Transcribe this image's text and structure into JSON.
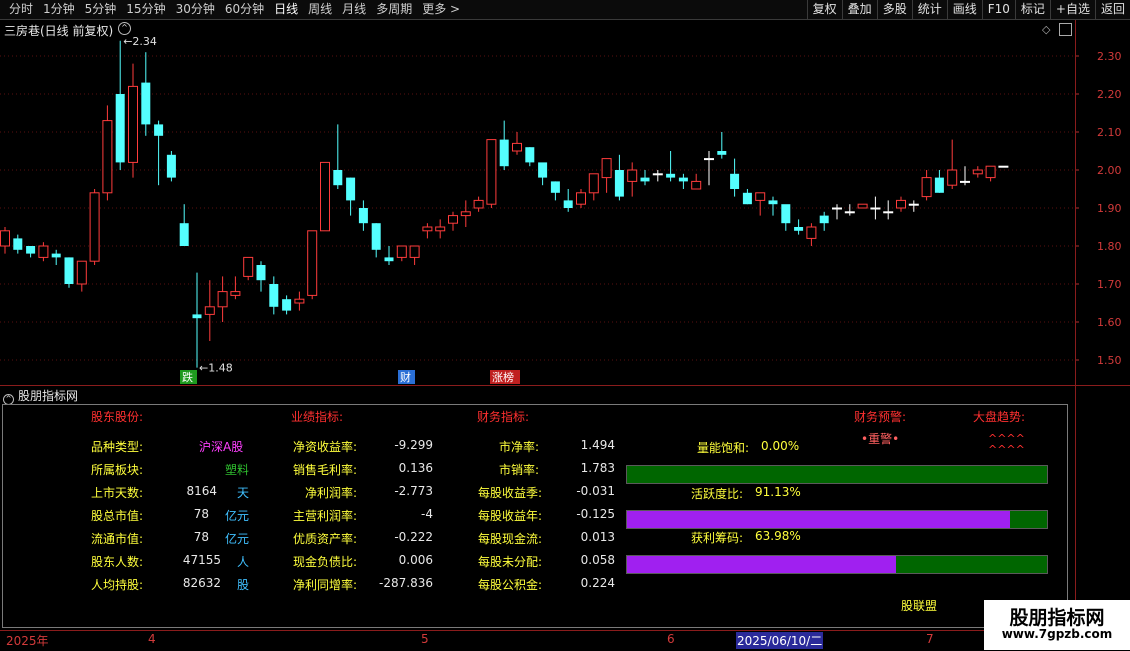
{
  "toolbar": {
    "periods": [
      "分时",
      "1分钟",
      "5分钟",
      "15分钟",
      "30分钟",
      "60分钟",
      "日线",
      "周线",
      "月线",
      "多周期",
      "更多 >"
    ],
    "active_period": "日线",
    "buttons": [
      "复权",
      "叠加",
      "多股",
      "统计",
      "画线",
      "F10",
      "标记",
      "+自选",
      "返回"
    ]
  },
  "chart": {
    "title": "三房巷(日线 前复权)",
    "price_ticks": [
      "2.30",
      "2.20",
      "2.10",
      "2.00",
      "1.90",
      "1.80",
      "1.70",
      "1.60",
      "1.50"
    ],
    "high_label": "2.34",
    "low_label": "1.48",
    "tags": [
      {
        "text": "跌",
        "color": "#1f9a1f"
      },
      {
        "text": "财",
        "color": "#2a6fd6"
      },
      {
        "text": "涨榜",
        "color": "#c02020"
      }
    ],
    "up_color": "#ff3c3c",
    "down_color": "#54ffff",
    "candles": [
      [
        1.8,
        1.84,
        1.85,
        1.78
      ],
      [
        1.82,
        1.79,
        1.83,
        1.78
      ],
      [
        1.8,
        1.78,
        1.8,
        1.77
      ],
      [
        1.77,
        1.8,
        1.81,
        1.76
      ],
      [
        1.78,
        1.77,
        1.79,
        1.75
      ],
      [
        1.77,
        1.7,
        1.77,
        1.69
      ],
      [
        1.7,
        1.76,
        1.76,
        1.68
      ],
      [
        1.76,
        1.94,
        1.95,
        1.75
      ],
      [
        1.94,
        2.13,
        2.17,
        1.92
      ],
      [
        2.2,
        2.02,
        2.34,
        2.0
      ],
      [
        2.02,
        2.22,
        2.28,
        1.98
      ],
      [
        2.23,
        2.12,
        2.31,
        2.09
      ],
      [
        2.12,
        2.09,
        2.13,
        1.96
      ],
      [
        2.04,
        1.98,
        2.05,
        1.97
      ],
      [
        1.86,
        1.8,
        1.91,
        1.8
      ],
      [
        1.62,
        1.61,
        1.73,
        1.48
      ],
      [
        1.62,
        1.64,
        1.71,
        1.55
      ],
      [
        1.64,
        1.68,
        1.72,
        1.6
      ],
      [
        1.67,
        1.68,
        1.72,
        1.66
      ],
      [
        1.72,
        1.77,
        1.75,
        1.71
      ],
      [
        1.75,
        1.71,
        1.76,
        1.68
      ],
      [
        1.7,
        1.64,
        1.72,
        1.62
      ],
      [
        1.66,
        1.63,
        1.67,
        1.62
      ],
      [
        1.65,
        1.66,
        1.68,
        1.63
      ],
      [
        1.67,
        1.84,
        1.84,
        1.66
      ],
      [
        1.84,
        2.02,
        2.02,
        1.9
      ],
      [
        2.0,
        1.96,
        2.12,
        1.95
      ],
      [
        1.98,
        1.92,
        1.98,
        1.88
      ],
      [
        1.9,
        1.86,
        1.92,
        1.84
      ],
      [
        1.86,
        1.79,
        1.86,
        1.77
      ],
      [
        1.77,
        1.76,
        1.8,
        1.75
      ],
      [
        1.77,
        1.8,
        1.8,
        1.76
      ],
      [
        1.77,
        1.8,
        1.8,
        1.75
      ],
      [
        1.84,
        1.85,
        1.86,
        1.82
      ],
      [
        1.84,
        1.85,
        1.87,
        1.82
      ],
      [
        1.86,
        1.88,
        1.89,
        1.84
      ],
      [
        1.88,
        1.89,
        1.92,
        1.85
      ],
      [
        1.9,
        1.92,
        1.93,
        1.89
      ],
      [
        1.91,
        2.08,
        2.08,
        1.9
      ],
      [
        2.08,
        2.01,
        2.13,
        2.0
      ],
      [
        2.05,
        2.07,
        2.1,
        2.04
      ],
      [
        2.06,
        2.02,
        2.06,
        2.01
      ],
      [
        2.02,
        1.98,
        2.01,
        1.96
      ],
      [
        1.97,
        1.94,
        1.97,
        1.92
      ],
      [
        1.92,
        1.9,
        1.95,
        1.89
      ],
      [
        1.91,
        1.94,
        1.95,
        1.9
      ],
      [
        1.94,
        1.99,
        1.99,
        1.92
      ],
      [
        1.98,
        2.03,
        2.03,
        1.94
      ],
      [
        2.0,
        1.93,
        2.04,
        1.92
      ],
      [
        1.97,
        2.0,
        2.02,
        1.93
      ],
      [
        1.98,
        1.97,
        2.0,
        1.96
      ],
      [
        1.99,
        1.99,
        2.0,
        1.97
      ],
      [
        1.99,
        1.98,
        2.05,
        1.97
      ],
      [
        1.98,
        1.97,
        1.99,
        1.95
      ],
      [
        1.95,
        1.97,
        1.99,
        1.95
      ],
      [
        2.03,
        2.03,
        2.05,
        1.96
      ],
      [
        2.05,
        2.04,
        2.1,
        2.03
      ],
      [
        1.99,
        1.95,
        2.03,
        1.93
      ],
      [
        1.94,
        1.91,
        1.95,
        1.91
      ],
      [
        1.92,
        1.94,
        1.94,
        1.88
      ],
      [
        1.92,
        1.91,
        1.93,
        1.88
      ],
      [
        1.91,
        1.86,
        1.9,
        1.84
      ],
      [
        1.85,
        1.84,
        1.87,
        1.83
      ],
      [
        1.82,
        1.85,
        1.86,
        1.8
      ],
      [
        1.88,
        1.86,
        1.89,
        1.84
      ],
      [
        1.9,
        1.9,
        1.91,
        1.87
      ],
      [
        1.89,
        1.89,
        1.91,
        1.88
      ],
      [
        1.9,
        1.91,
        1.9,
        1.91
      ],
      [
        1.9,
        1.9,
        1.93,
        1.87
      ],
      [
        1.89,
        1.89,
        1.92,
        1.87
      ],
      [
        1.9,
        1.92,
        1.93,
        1.89
      ],
      [
        1.91,
        1.91,
        1.92,
        1.89
      ],
      [
        1.93,
        1.98,
        2.0,
        1.92
      ],
      [
        1.98,
        1.94,
        2.0,
        1.94
      ],
      [
        1.96,
        2.0,
        2.08,
        1.95
      ],
      [
        1.97,
        1.97,
        2.01,
        1.96
      ],
      [
        1.99,
        2.0,
        2.01,
        1.98
      ],
      [
        1.98,
        2.01,
        2.01,
        1.97
      ],
      [
        2.01,
        2.01,
        2.01,
        2.01
      ]
    ]
  },
  "indicator": {
    "title": "股朋指标网",
    "headers": {
      "h1": "股东股份:",
      "h2": "业绩指标:",
      "h3": "财务指标:",
      "h4": "财务预警:",
      "h5": "大盘趋势:"
    },
    "col1": [
      {
        "label": "品种类型:",
        "value": "沪深A股"
      },
      {
        "label": "所属板块:",
        "value": "塑料"
      },
      {
        "label": "上市天数:",
        "value": "8164",
        "unit": "天"
      },
      {
        "label": "股总市值:",
        "value": "78",
        "unit": "亿元"
      },
      {
        "label": "流通市值:",
        "value": "78",
        "unit": "亿元"
      },
      {
        "label": "股东人数:",
        "value": "47155",
        "unit": "人"
      },
      {
        "label": "人均持股:",
        "value": "82632",
        "unit": "股"
      }
    ],
    "col2": [
      {
        "label": "净资收益率:",
        "value": "-9.299"
      },
      {
        "label": "销售毛利率:",
        "value": "0.136"
      },
      {
        "label": "净利润率:",
        "value": "-2.773"
      },
      {
        "label": "主营利润率:",
        "value": "-4"
      },
      {
        "label": "优质资产率:",
        "value": "-0.222"
      },
      {
        "label": "现金负债比:",
        "value": "0.006"
      },
      {
        "label": "净利同增率:",
        "value": "-287.836"
      }
    ],
    "col3": [
      {
        "label": "市净率:",
        "value": "1.494"
      },
      {
        "label": "市销率:",
        "value": "1.783"
      },
      {
        "label": "每股收益季:",
        "value": "-0.031"
      },
      {
        "label": "每股收益年:",
        "value": "-0.125"
      },
      {
        "label": "每股现金流:",
        "value": "0.013"
      },
      {
        "label": "每股未分配:",
        "value": "0.058"
      },
      {
        "label": "每股公积金:",
        "value": "0.224"
      }
    ],
    "warning": "•重警•",
    "trend_line1": "^^^^",
    "trend_line2": "^^^^",
    "meters": [
      {
        "label": "量能饱和:",
        "value": "0.00%",
        "fraction": 0.0
      },
      {
        "label": "活跃度比:",
        "value": "91.13%",
        "fraction": 0.9113
      },
      {
        "label": "获利筹码:",
        "value": "63.98%",
        "fraction": 0.6398
      }
    ],
    "footer": "股联盟"
  },
  "time_axis": {
    "labels": [
      "2025年",
      "4",
      "5",
      "6",
      "7"
    ],
    "selected": "2025/06/10/二"
  },
  "watermark": {
    "title": "股朋指标网",
    "url": "www.7gpzb.com"
  }
}
